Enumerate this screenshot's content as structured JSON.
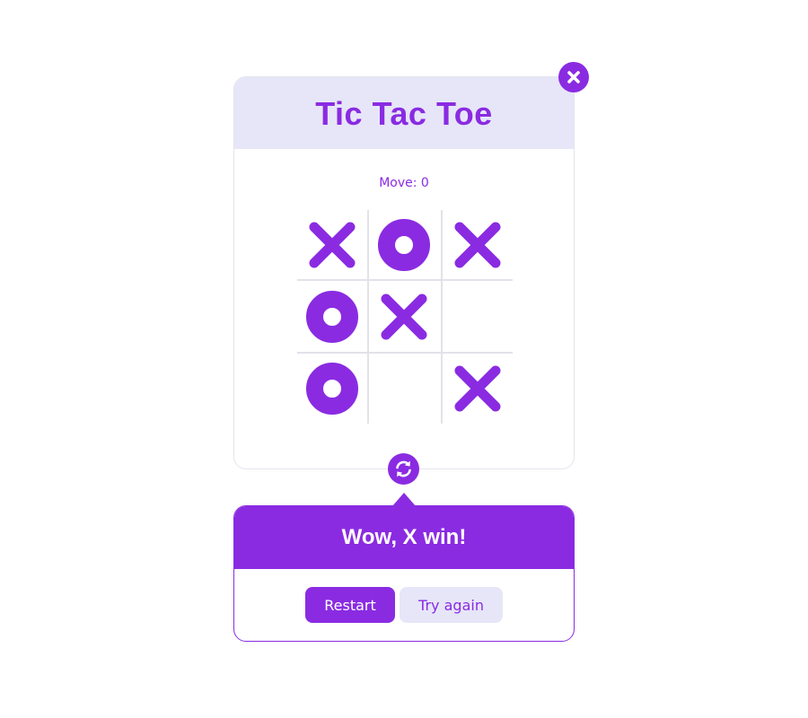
{
  "game": {
    "title": "Tic Tac Toe",
    "move_label": "Move: 0",
    "board": [
      "X",
      "O",
      "X",
      "O",
      "X",
      "",
      "O",
      "",
      "X"
    ]
  },
  "result": {
    "message": "Wow, X win!",
    "restart_label": "Restart",
    "try_again_label": "Try again"
  },
  "icons": {
    "close": "close-icon",
    "refresh": "refresh-icon"
  },
  "colors": {
    "accent": "#8a2be2",
    "header_bg": "#e6e6f8",
    "grid": "#e2e2ea"
  }
}
